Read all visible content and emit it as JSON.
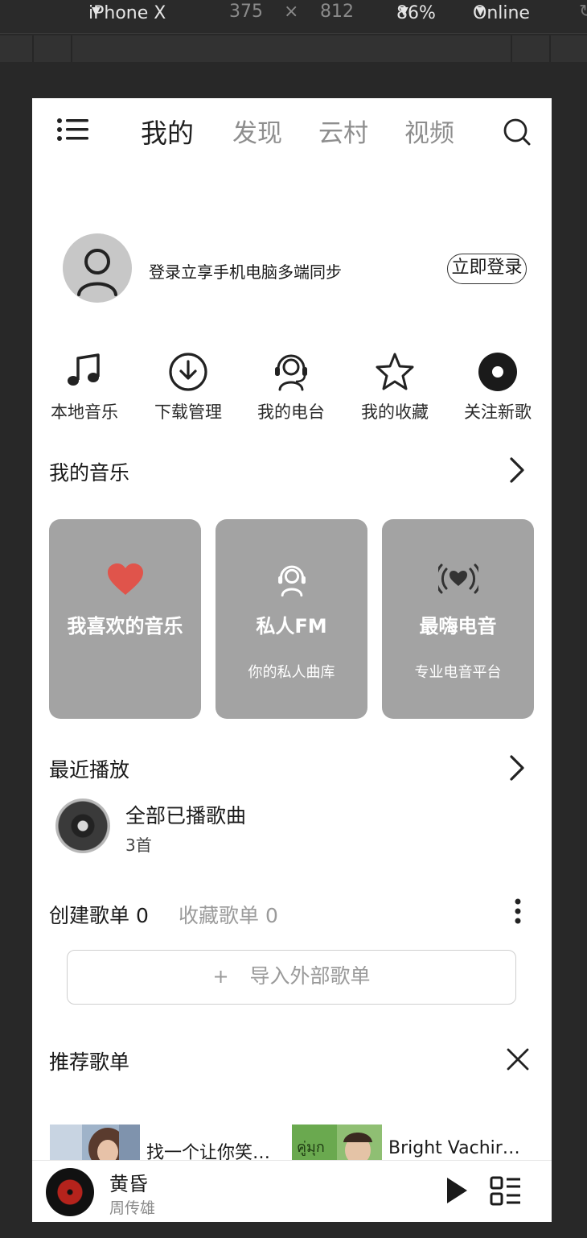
{
  "devtools": {
    "device": "iPhone X",
    "width": "375",
    "times": "×",
    "height": "812",
    "zoom": "86%",
    "network": "Online"
  },
  "nav": {
    "tabs": [
      {
        "label": "我的",
        "active": true
      },
      {
        "label": "发现",
        "active": false
      },
      {
        "label": "云村",
        "active": false
      },
      {
        "label": "视频",
        "active": false
      }
    ]
  },
  "profile": {
    "hint": "登录立享手机电脑多端同步",
    "login_button": "立即登录"
  },
  "quick_actions": [
    {
      "label": "本地音乐",
      "icon": "music-note-icon"
    },
    {
      "label": "下载管理",
      "icon": "download-icon"
    },
    {
      "label": "我的电台",
      "icon": "radio-dj-icon"
    },
    {
      "label": "我的收藏",
      "icon": "star-icon"
    },
    {
      "label": "关注新歌",
      "icon": "disc-icon"
    }
  ],
  "my_music": {
    "title": "我的音乐",
    "cards": [
      {
        "title": "我喜欢的音乐",
        "subtitle": "",
        "icon": "heart-icon",
        "icon_color": "#e0544b"
      },
      {
        "title": "私人FM",
        "subtitle": "你的私人曲库",
        "icon": "headset-icon"
      },
      {
        "title": "最嗨电音",
        "subtitle": "专业电音平台",
        "icon": "broadcast-heart-icon"
      }
    ]
  },
  "recent": {
    "title": "最近播放",
    "item_title": "全部已播歌曲",
    "item_count": "3首"
  },
  "playlists": {
    "created_tab": "创建歌单 0",
    "collected_tab": "收藏歌单 0",
    "import_plus": "+",
    "import_label": "导入外部歌单"
  },
  "recommended": {
    "title": "推荐歌单",
    "items": [
      {
        "title": "找一个让你笑…"
      },
      {
        "title": "Bright Vachir…"
      }
    ]
  },
  "player": {
    "song": "黄昏",
    "artist": "周传雄"
  },
  "colors": {
    "card_bg": "#a3a3a3",
    "heart": "#e0544b",
    "record": "#b5231c"
  }
}
